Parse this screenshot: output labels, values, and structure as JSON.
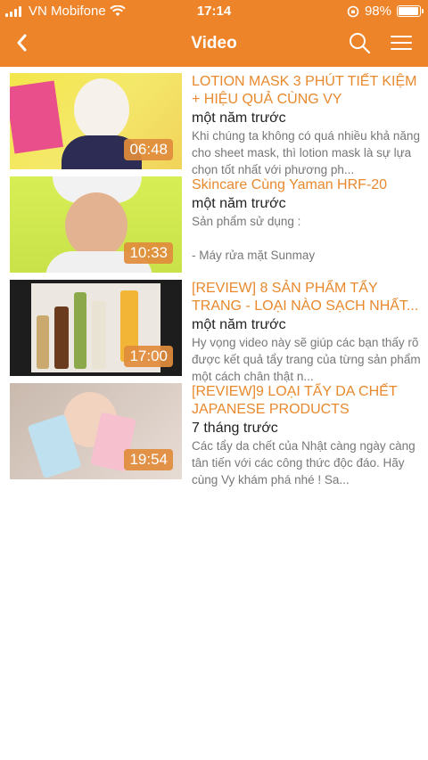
{
  "status": {
    "carrier": "VN Mobifone",
    "time": "17:14",
    "battery": "98%"
  },
  "nav": {
    "title": "Video"
  },
  "videos": [
    {
      "title": "LOTION MASK 3 PHÚT TIẾT KIỆM + HIỆU QUẢ CÙNG VY",
      "date": "một năm trước",
      "desc": "Khi chúng ta không có quá nhiều khả năng cho sheet mask, thì lotion mask là sự lựa chọn tốt nhất với phương ph...",
      "duration": "06:48"
    },
    {
      "title": "Skincare Cùng Yaman HRF-20",
      "date": "một năm trước",
      "desc": "Sản phẩm sử dụng :\n\n- Máy rửa mặt Sunmay",
      "duration": "10:33"
    },
    {
      "title": "[REVIEW] 8 SẢN PHẨM TẨY TRANG - LOẠI NÀO SẠCH NHẤT...",
      "date": "một năm trước",
      "desc": "Hy vọng video này sẽ giúp các bạn thấy rõ được kết quả tẩy trang của từng sản phẩm một cách chân thật n...",
      "duration": "17:00"
    },
    {
      "title": "[REVIEW]9 LOẠI TẨY DA CHẾT JAPANESE PRODUCTS",
      "date": "7 tháng trước",
      "desc": "Các tẩy da chết của Nhật càng ngày càng tân tiến với các công thức độc đáo. Hãy cùng Vy khám phá nhé ! Sa...",
      "duration": "19:54"
    }
  ]
}
